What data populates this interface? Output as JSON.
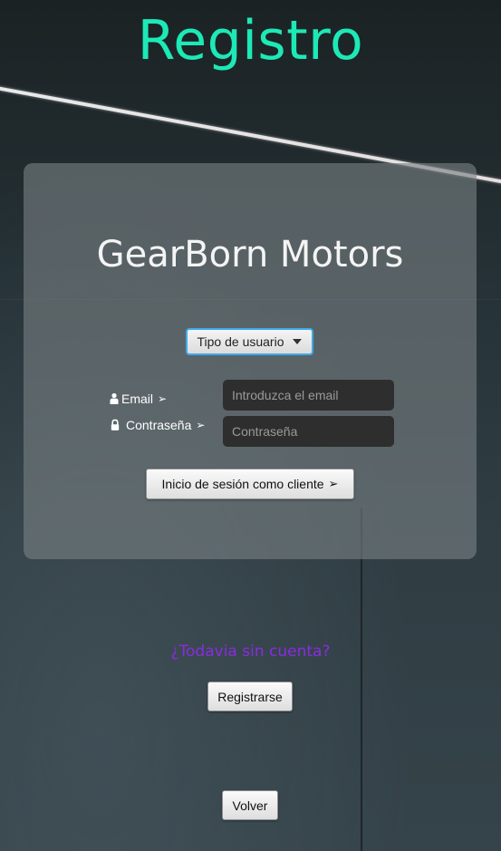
{
  "header": {
    "title": "Registro"
  },
  "panel": {
    "brand": "GearBorn Motors",
    "user_type_dropdown": {
      "selected": "Tipo de usuario",
      "icon": "chevron-down-icon"
    },
    "email": {
      "label": "Email",
      "icon": "person-icon",
      "arrow": "➢",
      "placeholder": "Introduzca el email",
      "value": ""
    },
    "password": {
      "label": "Contraseña",
      "icon": "lock-icon",
      "arrow": "➢",
      "placeholder": "Contraseña",
      "value": ""
    },
    "login_button": {
      "label": "Inicio de sesión como cliente",
      "arrow": "➢"
    }
  },
  "footer": {
    "no_account_text": "¿Todavia sin cuenta?",
    "register_label": "Registrarse",
    "back_label": "Volver"
  },
  "colors": {
    "title": "#1de9b6",
    "no_account": "#8a2be2",
    "dropdown_focus": "#3fa9e8"
  }
}
